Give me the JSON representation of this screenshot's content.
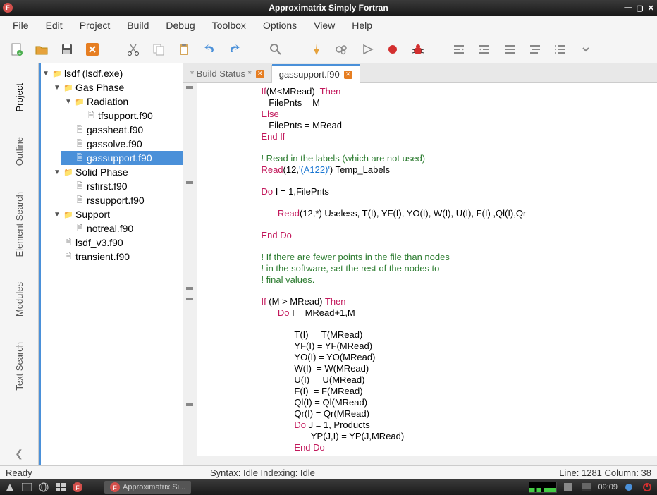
{
  "title": "Approximatrix Simply Fortran",
  "menu": [
    "File",
    "Edit",
    "Project",
    "Build",
    "Debug",
    "Toolbox",
    "Options",
    "View",
    "Help"
  ],
  "sidetabs": [
    "Project",
    "Outline",
    "Element Search",
    "Modules",
    "Text Search"
  ],
  "tree": {
    "root": "lsdf (lsdf.exe)",
    "gasphase": "Gas Phase",
    "radiation": "Radiation",
    "tfsupport": "tfsupport.f90",
    "gassheat": "gassheat.f90",
    "gassolve": "gassolve.f90",
    "gassupport": "gassupport.f90",
    "solidphase": "Solid Phase",
    "rsfirst": "rsfirst.f90",
    "rssupport": "rssupport.f90",
    "support": "Support",
    "notreal": "notreal.f90",
    "lsdfv3": "lsdf_v3.f90",
    "transient": "transient.f90"
  },
  "tabs": {
    "build": "* Build Status *",
    "gassupport": "gassupport.f90"
  },
  "code": {
    "l1": {
      "a": "If",
      "b": "(M<MRead)  ",
      "c": "Then"
    },
    "l2": "   FilePnts = M",
    "l3": "Else",
    "l4": "   FilePnts = MRead",
    "l5": "End If",
    "l6": "! Read in the labels (which are not used)",
    "l7a": "Read",
    "l7b": "(12,",
    "l7c": "'(A122)'",
    "l7d": ") Temp_Labels",
    "l8a": "Do",
    "l8b": " I = 1,FilePnts",
    "l9a": "Read",
    "l9b": "(12,*) Useless, T(I), YF(I), YO(I), W(I), U(I), F(I) ,Ql(I),Qr",
    "l10": "End Do",
    "l11": "! If there are fewer points in the file than nodes",
    "l12": "! in the software, set the rest of the nodes to",
    "l13": "! final values.",
    "l14a": "If",
    "l14b": " (M > MRead) ",
    "l14c": "Then",
    "l15a": "Do",
    "l15b": " I = MRead+1,M",
    "l16": "T(I)  = T(MRead)",
    "l17": "YF(I) = YF(MRead)",
    "l18": "YO(I) = YO(MRead)",
    "l19": "W(I)  = W(MRead)",
    "l20": "U(I)  = U(MRead)",
    "l21": "F(I)  = F(MRead)",
    "l22": "Ql(I) = Ql(MRead)",
    "l23": "Qr(I) = Qr(MRead)",
    "l24a": "Do",
    "l24b": " J = 1, Products",
    "l25": "YP(J,I) = YP(J,MRead)",
    "l26": "End Do"
  },
  "status": {
    "ready": "Ready",
    "syntax": "Syntax: Idle  Indexing: Idle",
    "pos": "Line: 1281 Column: 38"
  },
  "taskbar": {
    "app": "Approximatrix Si...",
    "time": "09:09"
  }
}
